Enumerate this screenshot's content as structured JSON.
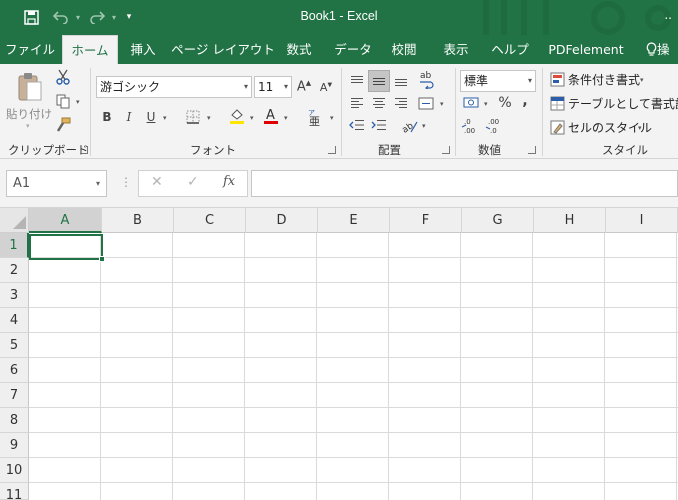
{
  "app": {
    "title": "Book1  -  Excel",
    "title_more": "..",
    "accent": "#217346"
  },
  "quick_access": {
    "save_icon": "save-icon",
    "undo_icon": "undo-icon",
    "redo_icon": "redo-icon",
    "customize_icon": "customize-qat-icon"
  },
  "tabs": [
    {
      "label": "ファイル"
    },
    {
      "label": "ホーム",
      "active": true
    },
    {
      "label": "挿入"
    },
    {
      "label": "ページ レイアウト"
    },
    {
      "label": "数式"
    },
    {
      "label": "データ"
    },
    {
      "label": "校閲"
    },
    {
      "label": "表示"
    },
    {
      "label": "ヘルプ"
    },
    {
      "label": "PDFelement"
    },
    {
      "label": "操"
    }
  ],
  "ribbon": {
    "clipboard": {
      "label": "クリップボード",
      "paste_label": "貼り付け"
    },
    "font": {
      "label": "フォント",
      "font_name": "游ゴシック",
      "font_size": "11",
      "bold": "B",
      "italic": "I",
      "underline": "U"
    },
    "alignment": {
      "label": "配置"
    },
    "number": {
      "label": "数値",
      "format": "標準",
      "percent": "%",
      "comma": ","
    },
    "styles": {
      "label": "スタイル",
      "conditional": "条件付き書式",
      "table": "テーブルとして書式設定",
      "cell_styles": "セルのスタイル"
    }
  },
  "formula_bar": {
    "name_box": "A1",
    "cancel": "✕",
    "enter": "✓",
    "fx": "fx",
    "content": ""
  },
  "grid": {
    "columns": [
      "A",
      "B",
      "C",
      "D",
      "E",
      "F",
      "G",
      "H",
      "I"
    ],
    "rows": [
      "1",
      "2",
      "3",
      "4",
      "5",
      "6",
      "7",
      "8",
      "9",
      "10",
      "11"
    ],
    "selected_cell": "A1"
  }
}
